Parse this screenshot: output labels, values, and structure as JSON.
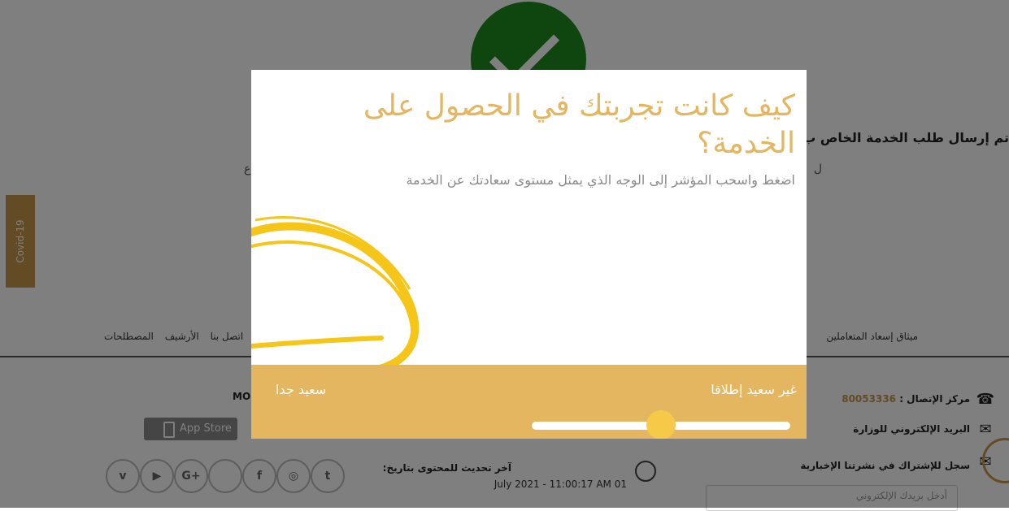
{
  "background": {
    "success_title": "تم إرسال طلب الخدمة الخاص ب",
    "success_sub_right": "ل",
    "success_sub_left": "ع",
    "covid_tab": "Covid-19",
    "nav": {
      "left_items": [
        "اتصل بنا",
        "الأرشيف",
        "المصطلحات"
      ],
      "right_item": "ميثاق إسعاد المتعاملين"
    },
    "contacts": {
      "call_center_label": "مركز الإتصال : ",
      "call_center_number": "80053336",
      "email_label": "البريد الإلكتروني للوزارة",
      "newsletter_label": "سجل للإشتراك في نشرتنا الإخبارية",
      "email_placeholder": "أدخل بريدك الإلكتروني"
    },
    "mof_label": "MOF",
    "app_store_label": "App Store",
    "update_title": "آخر تحديث للمحتوى بتاريخ:",
    "update_date": "July 2021 - 11:00:17 AM 01",
    "social_icons": [
      "vimeo",
      "youtube",
      "google-plus",
      "blank",
      "facebook",
      "instagram",
      "twitter"
    ]
  },
  "modal": {
    "title": "كيف كانت تجربتك في الحصول على الخدمة؟",
    "subtitle": "اضغط واسحب المؤشر إلى الوجه الذي يمثل مستوى سعادتك عن الخدمة",
    "label_unhappy": "غير سعيد إطلاقا",
    "label_happy": "سعيد جدا",
    "slider_value": 0.5
  },
  "colors": {
    "accent": "#e3b65f",
    "thumb": "#f7c948",
    "success_green": "#1f8a1f"
  }
}
